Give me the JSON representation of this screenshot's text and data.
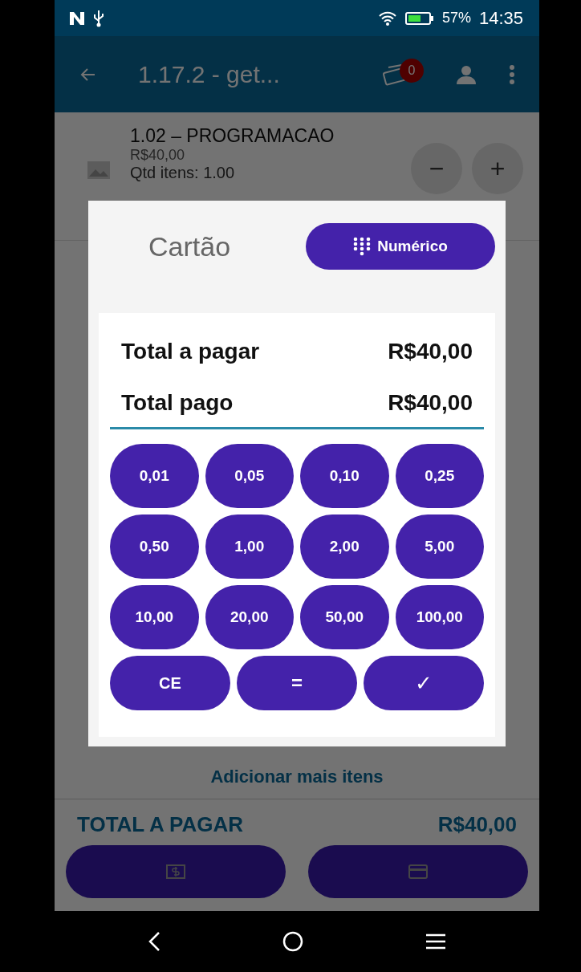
{
  "status_bar": {
    "battery": "57%",
    "time": "14:35"
  },
  "app_bar": {
    "title": "1.17.2 - get...",
    "badge": "0"
  },
  "item": {
    "name": "1.02 – PROGRAMACAO",
    "price": "R$40,00",
    "quantity": "Qtd itens: 1.00",
    "minus": "−",
    "plus": "+"
  },
  "add_more": "Adicionar mais itens",
  "total": {
    "label": "TOTAL A PAGAR",
    "value": "R$40,00"
  },
  "dialog": {
    "title": "Cartão",
    "mode_button": "Numérico",
    "rows": [
      {
        "label": "Total a pagar",
        "value": "R$40,00"
      },
      {
        "label": "Total pago",
        "value": "R$40,00"
      }
    ],
    "keys": [
      "0,01",
      "0,05",
      "0,10",
      "0,25",
      "0,50",
      "1,00",
      "2,00",
      "5,00",
      "10,00",
      "20,00",
      "50,00",
      "100,00"
    ],
    "actions": [
      {
        "kind": "clear",
        "label": "CE"
      },
      {
        "kind": "equals",
        "label": "="
      },
      {
        "kind": "confirm",
        "label": "✓"
      }
    ]
  }
}
